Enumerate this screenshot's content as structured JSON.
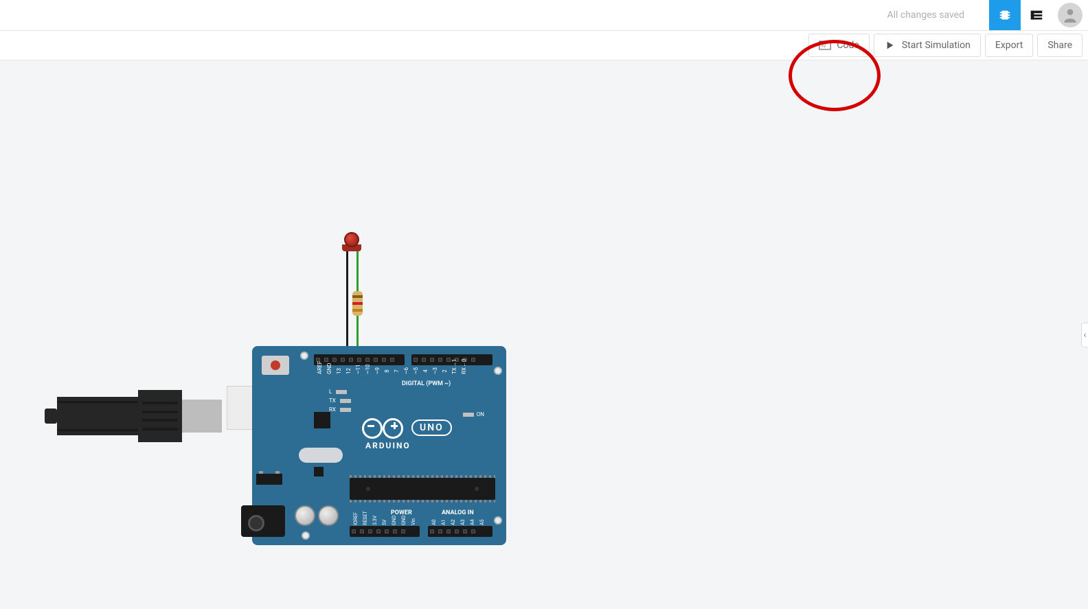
{
  "topbar": {
    "save_status": "All changes saved"
  },
  "toolbar": {
    "code_label": "Code",
    "simulate_label": "Start Simulation",
    "export_label": "Export",
    "share_label": "Share"
  },
  "board": {
    "brand": "ARDUINO",
    "model": "UNO",
    "section_digital": "DIGITAL (PWM ~)",
    "section_power": "POWER",
    "section_analog": "ANALOG IN",
    "led_L": "L",
    "led_TX": "TX",
    "led_RX": "RX",
    "led_ON": "ON",
    "digital_pins": [
      "AREF",
      "GND",
      "13",
      "12",
      "~11",
      "~10",
      "~9",
      "8",
      "7",
      "~6",
      "~5",
      "4",
      "~3",
      "2",
      "TX→1",
      "RX←0"
    ],
    "power_pins": [
      "IOREF",
      "RESET",
      "3.3V",
      "5V",
      "GND",
      "GND",
      "Vin"
    ],
    "analog_pins": [
      "A0",
      "A1",
      "A2",
      "A3",
      "A4",
      "A5"
    ]
  },
  "components": {
    "led_color": "#c23a2a",
    "resistor_bands": [
      "brown",
      "red",
      "orange"
    ]
  },
  "side_tab_glyph": "‹"
}
